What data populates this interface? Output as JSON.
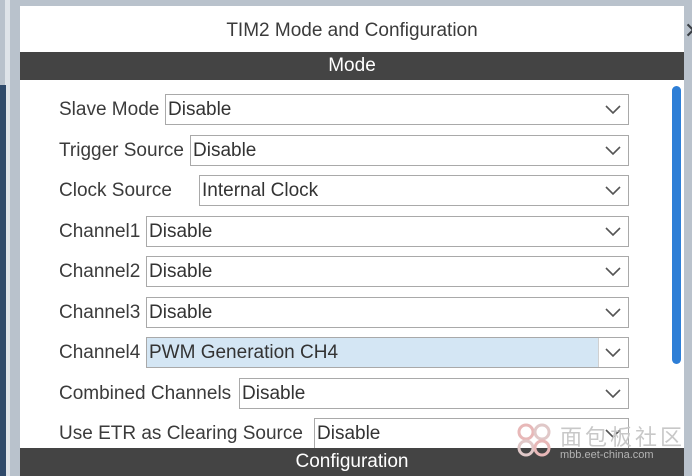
{
  "window": {
    "title": "TIM2 Mode and Configuration"
  },
  "sections": {
    "mode": "Mode",
    "configuration": "Configuration"
  },
  "rows": [
    {
      "label": "Slave Mode",
      "value": "Disable"
    },
    {
      "label": "Trigger Source",
      "value": "Disable"
    },
    {
      "label": "Clock Source",
      "value": "Internal Clock"
    },
    {
      "label": "Channel1",
      "value": "Disable"
    },
    {
      "label": "Channel2",
      "value": "Disable"
    },
    {
      "label": "Channel3",
      "value": "Disable"
    },
    {
      "label": "Channel4",
      "value": "PWM Generation CH4",
      "selected": true
    },
    {
      "label": "Combined Channels",
      "value": "Disable"
    },
    {
      "label": "Use ETR as Clearing Source",
      "value": "Disable"
    }
  ],
  "watermark": {
    "text": "面包板社区",
    "url": "mbb.eet-china.com"
  },
  "colors": {
    "section_bar": "#444444",
    "highlight": "#d4e6f4",
    "scroll_thumb": "#2d7ed6"
  },
  "icons": {
    "dropdown": "chevron-down-icon",
    "close": "close-icon"
  }
}
